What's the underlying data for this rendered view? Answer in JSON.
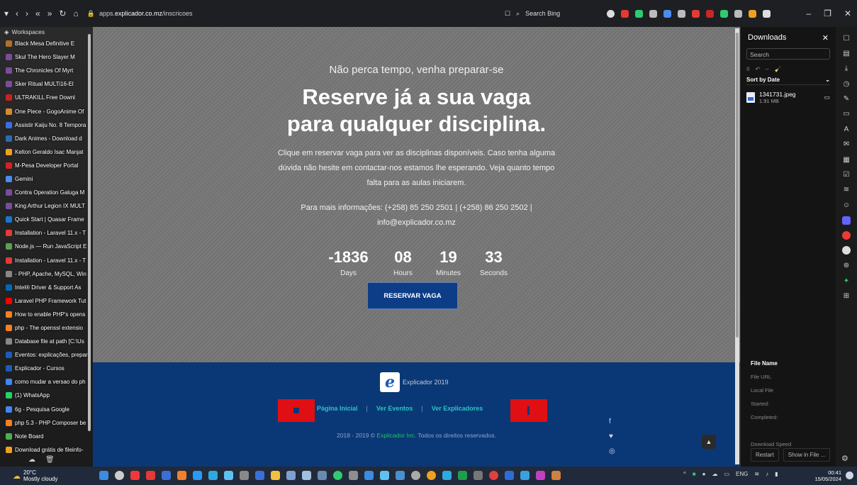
{
  "browser": {
    "url_prefix": "apps.",
    "url_domain": "explicador.co.mz",
    "url_path": "/inscricoes",
    "search_placeholder": "Search Bing"
  },
  "sidebar": {
    "workspaces_label": "Workspaces",
    "tabs": [
      {
        "label": "Black Mesa Definitive E",
        "color": "#b06f2c"
      },
      {
        "label": "Skul The Hero Slayer M",
        "color": "#7a4c9d"
      },
      {
        "label": "The Chronicles Of Myrt",
        "color": "#7a4c9d"
      },
      {
        "label": "Sker Ritual MULTi16-El",
        "color": "#7a4c9d"
      },
      {
        "label": "ULTRAKILL Free Downl",
        "color": "#c82222"
      },
      {
        "label": "One Piece - GogoAnime Of",
        "color": "#d78a2b"
      },
      {
        "label": "Assistir Kaiju No. 8 Tempora",
        "color": "#3b6ee0"
      },
      {
        "label": "Dark Animes - Download d",
        "color": "#2c6bb2"
      },
      {
        "label": "Kelton Geraldo Isac Manjat",
        "color": "#f0a020"
      },
      {
        "label": "M-Pesa Developer Portal",
        "color": "#d42222"
      },
      {
        "label": "Gemini",
        "color": "#4a8cf0"
      },
      {
        "label": "Contra Operation Galuga M",
        "color": "#7a4c9d"
      },
      {
        "label": "King Arthur Legion IX MULT",
        "color": "#7a4c9d"
      },
      {
        "label": "Quick Start | Quasar Frame",
        "color": "#1976d2"
      },
      {
        "label": "Installation - Laravel 11.x - T",
        "color": "#e53935"
      },
      {
        "label": "Node.js — Run JavaScript E",
        "color": "#5fa04e"
      },
      {
        "label": "Installation - Laravel 11.x - T",
        "color": "#e53935"
      },
      {
        "label": "- PHP, Apache, MySQL, Win",
        "color": "#888888"
      },
      {
        "label": "Intel® Driver & Support As",
        "color": "#0068b5"
      },
      {
        "label": "Laravel PHP Framework Tut",
        "color": "#ff0000"
      },
      {
        "label": "How to enable PHP's opens",
        "color": "#f48024"
      },
      {
        "label": "php - The openssl extensio",
        "color": "#f48024"
      },
      {
        "label": "Database file at path [C:\\Us",
        "color": "#888888"
      },
      {
        "label": "Eventos: explicações, prepar",
        "color": "#1c5bb8"
      },
      {
        "label": "Explicador - Cursos",
        "color": "#1c5bb8"
      },
      {
        "label": "como mudar a versao do ph",
        "color": "#4285f4"
      },
      {
        "label": "(1) WhatsApp",
        "color": "#25d366"
      },
      {
        "label": "6g - Pesquisa Google",
        "color": "#4285f4"
      },
      {
        "label": "php 5.3 - PHP Composer be",
        "color": "#f48024"
      },
      {
        "label": "Note Board",
        "color": "#4caf50"
      },
      {
        "label": "Download grátis de fileinfo-",
        "color": "#f0a020"
      }
    ]
  },
  "hero": {
    "subtitle": "Não perca tempo, venha preparar-se",
    "title_line1": "Reserve já a sua vaga",
    "title_line2": "para qualquer disciplina.",
    "description": "Clique em reservar vaga para ver as disciplinas disponíveis. Caso tenha alguma dúvida não hesite em contactar-nos estamos lhe esperando. Veja quanto tempo falta para as aulas iniciarem.",
    "info_line1": "Para mais informações: (+258) 85 250 2501 | (+258) 86 250 2502 |",
    "info_line2": "info@explicador.co.mz",
    "countdown": {
      "days": "-1836",
      "days_label": "Days",
      "hours": "08",
      "hours_label": "Hours",
      "minutes": "19",
      "minutes_label": "Minutes",
      "seconds": "33",
      "seconds_label": "Seconds"
    },
    "reserve_button": "RESERVAR VAGA"
  },
  "footer": {
    "logo_letter": "e",
    "logo_text": "Explicador 2019",
    "nav": [
      "Página Inicial",
      "Ver Eventos",
      "Ver Explicadores"
    ],
    "separator": "|",
    "copyright_prefix": "2018 - 2019 ©",
    "copyright_company": "Explicador Inc",
    "copyright_suffix": ". Todos os direitos reservados."
  },
  "downloads": {
    "title": "Downloads",
    "search_placeholder": "Search",
    "sort_label": "Sort by Date",
    "file_name": "1341731.jpeg",
    "file_size": "1.91 MB",
    "meta_head": "File Name",
    "meta": [
      "File URL",
      "Local File",
      "Started:",
      "Completed:",
      "",
      "Download Speed"
    ],
    "restart": "Restart",
    "show_in_file": "Show in File ..."
  },
  "taskbar": {
    "temp": "20°C",
    "weather": "Mostly cloudy",
    "lang": "ENG",
    "time": "00:41",
    "date": "15/05/2024"
  }
}
